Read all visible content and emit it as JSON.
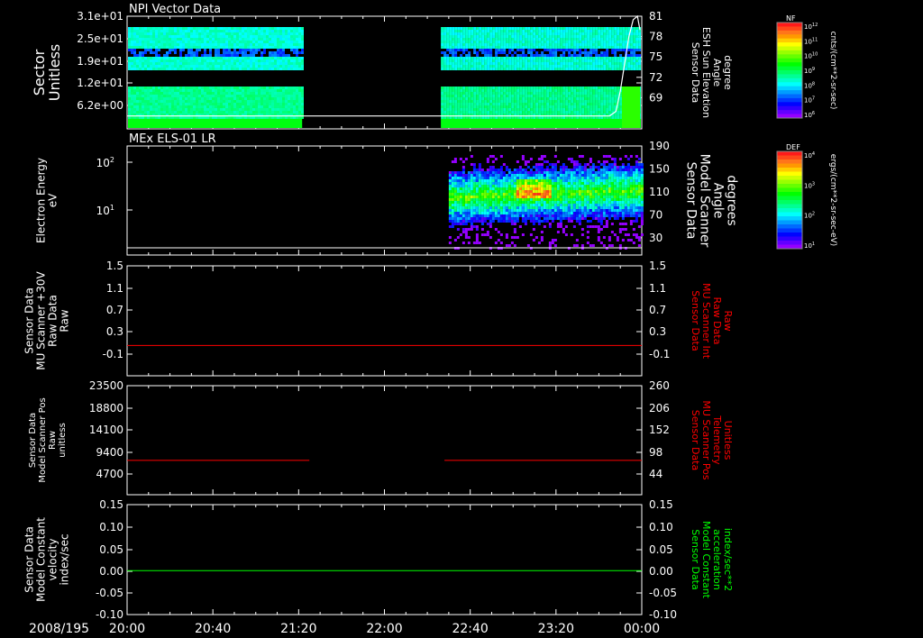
{
  "colors": {
    "background": "#000000",
    "axis": "#ffffff",
    "red_trace": "#ff0000",
    "green_trace": "#00ff00"
  },
  "time_axis": {
    "date_label": "2008/195",
    "ticks": [
      "20:00",
      "20:40",
      "21:20",
      "22:00",
      "22:40",
      "23:20",
      "00:00"
    ]
  },
  "chart_data": [
    {
      "type": "heatmap",
      "panel": "NPI Vector Data",
      "title": "NPI Vector Data",
      "ylabel": [
        "Sector",
        "Unitless"
      ],
      "yticks": [
        "3.1e+01",
        "2.5e+01",
        "1.9e+01",
        "1.2e+01",
        "6.2e+00"
      ],
      "y2label": [
        "Sensor Data",
        "ESH Sun Elevation",
        "Angle",
        "degree"
      ],
      "y2ticks": [
        81,
        78,
        75,
        72,
        69
      ],
      "y2lim": [
        66,
        81
      ],
      "data_gap": [
        "21:25",
        "22:28"
      ],
      "colorbar": {
        "label": "NF",
        "unit": "cnts/(cm**2-sr-sec)",
        "ticks": [
          "10^12",
          "10^11",
          "10^10",
          "10^9",
          "10^8",
          "10^7",
          "10^6"
        ]
      },
      "overlay_line": {
        "x": [
          "20:00",
          "23:45",
          "23:48",
          "23:50",
          "23:52",
          "23:54",
          "23:56",
          "23:58",
          "00:00"
        ],
        "y": [
          66.3,
          66.3,
          67,
          70,
          74,
          78,
          80.5,
          81,
          79
        ]
      }
    },
    {
      "type": "heatmap",
      "panel": "MEx ELS-01 LR",
      "title": "MEx ELS-01 LR",
      "ylabel": [
        "Electron Energy",
        "eV"
      ],
      "yticks": [
        "10^2",
        "10^1"
      ],
      "y2label": [
        "Sensor Data",
        "Model Scanner",
        "Angle",
        "degrees"
      ],
      "y2ticks": [
        190,
        150,
        110,
        70,
        30
      ],
      "y2lim": [
        0,
        190
      ],
      "data_start": "22:30",
      "colorbar": {
        "label": "DEF",
        "unit": "ergs/(cm**2-sr-sec-eV)",
        "ticks": [
          "10^4",
          "10^3",
          "10^2",
          "10^1"
        ]
      }
    },
    {
      "type": "line",
      "ylabel": [
        "Sensor Data",
        "MU Scanner +30V",
        "Raw Data",
        "Raw"
      ],
      "yticks": [
        "1.5",
        "1.1",
        "0.7",
        "0.3",
        "-0.1"
      ],
      "ylim": [
        -0.5,
        1.5
      ],
      "y2label": [
        "Sensor Data",
        "MU Scanner Int",
        "Raw Data",
        "Raw"
      ],
      "y2ticks": [
        "1.5",
        "1.1",
        "0.7",
        "0.3",
        "-0.1"
      ],
      "series": [
        {
          "color": "red",
          "x": [
            "20:00",
            "00:00"
          ],
          "y": [
            0.05,
            0.05
          ]
        }
      ]
    },
    {
      "type": "line",
      "ylabel": [
        "Sensor Data",
        "Model Scanner Pos",
        "Raw",
        "unitless"
      ],
      "yticks": [
        "23500",
        "18800",
        "14100",
        "9400",
        "4700"
      ],
      "ylim": [
        0,
        23500
      ],
      "y2label": [
        "Sensor Data",
        "MU Scanner Pos",
        "Telemetry",
        "Unitless"
      ],
      "y2ticks": [
        "260",
        "206",
        "152",
        "98",
        "44"
      ],
      "series": [
        {
          "color": "red",
          "x": [
            "20:00",
            "21:25"
          ],
          "y": [
            7400,
            7400
          ]
        },
        {
          "color": "red",
          "x": [
            "22:28",
            "00:00"
          ],
          "y": [
            7400,
            7400
          ]
        }
      ]
    },
    {
      "type": "line",
      "ylabel": [
        "Sensor Data",
        "Model Constant",
        "velocity",
        "index/sec"
      ],
      "yticks": [
        "0.15",
        "0.10",
        "0.05",
        "0.00",
        "-0.05",
        "-0.10"
      ],
      "ylim": [
        -0.1,
        0.15
      ],
      "y2label": [
        "Sensor Data",
        "Model Constant",
        "acceleration",
        "index/sec**2"
      ],
      "y2ticks": [
        "0.15",
        "0.10",
        "0.05",
        "0.00",
        "-0.05",
        "-0.10"
      ],
      "series": [
        {
          "color": "green",
          "x": [
            "20:00",
            "00:00"
          ],
          "y": [
            0,
            0
          ]
        }
      ]
    }
  ]
}
